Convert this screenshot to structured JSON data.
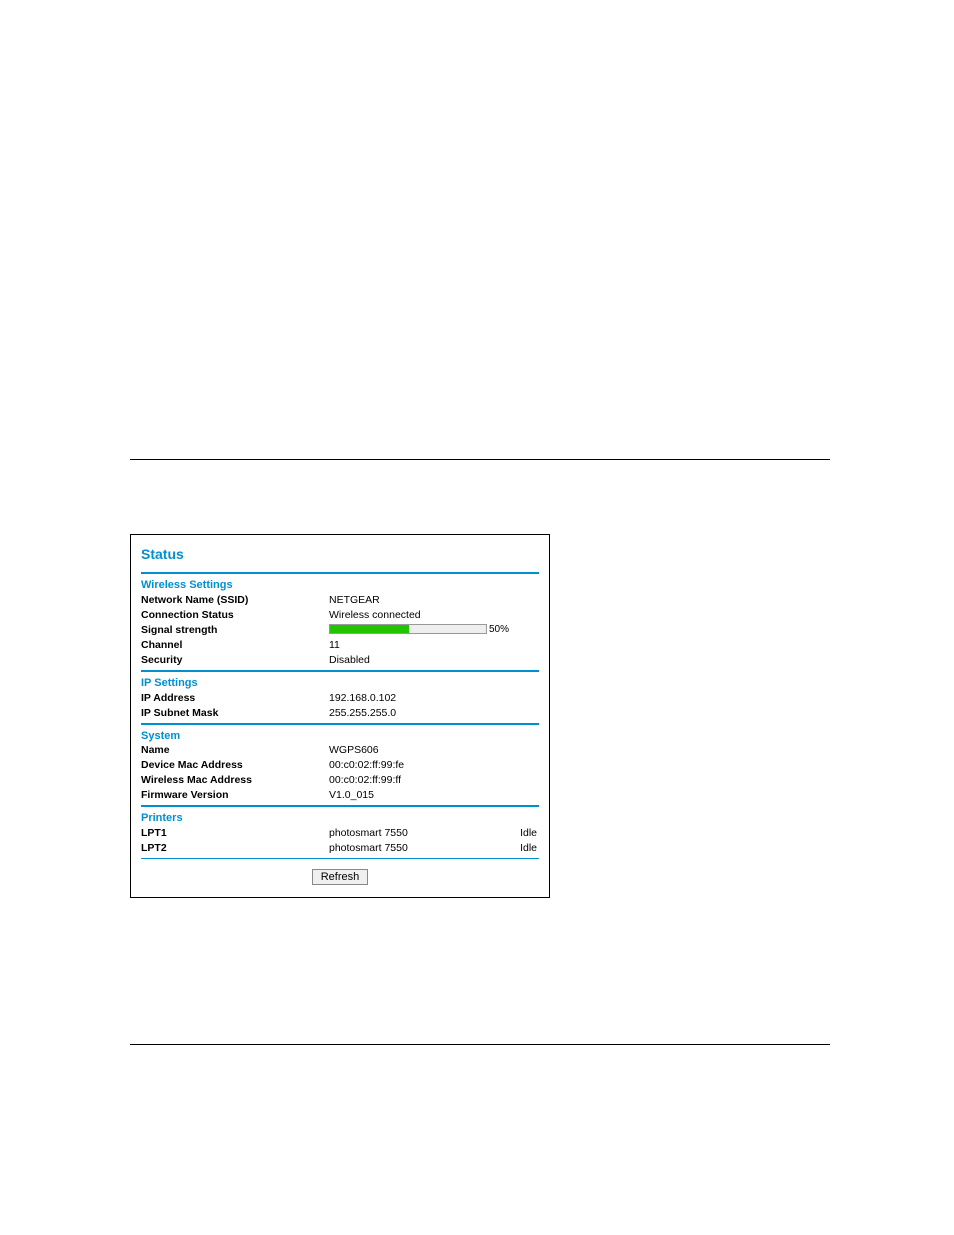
{
  "panel_title": "Status",
  "sections": {
    "wireless": {
      "heading": "Wireless Settings",
      "ssid": {
        "label": "Network Name (SSID)",
        "value": "NETGEAR"
      },
      "conn": {
        "label": "Connection Status",
        "value": "Wireless connected"
      },
      "signal": {
        "label": "Signal strength",
        "percent_text": "50%",
        "fill_width_px": "79"
      },
      "channel": {
        "label": "Channel",
        "value": "11"
      },
      "security": {
        "label": "Security",
        "value": "Disabled"
      }
    },
    "ip": {
      "heading": "IP Settings",
      "addr": {
        "label": "IP Address",
        "value": "192.168.0.102"
      },
      "mask": {
        "label": "IP Subnet Mask",
        "value": "255.255.255.0"
      }
    },
    "system": {
      "heading": "System",
      "name": {
        "label": "Name",
        "value": "WGPS606"
      },
      "devmac": {
        "label": "Device Mac Address",
        "value": "00:c0:02:ff:99:fe"
      },
      "wlmac": {
        "label": "Wireless Mac Address",
        "value": "00:c0:02:ff:99:ff"
      },
      "fw": {
        "label": "Firmware Version",
        "value": "V1.0_015"
      }
    },
    "printers": {
      "heading": "Printers",
      "p1": {
        "label": "LPT1",
        "value": "photosmart 7550",
        "status": "Idle"
      },
      "p2": {
        "label": "LPT2",
        "value": "photosmart 7550",
        "status": "Idle"
      }
    }
  },
  "refresh_label": "Refresh"
}
